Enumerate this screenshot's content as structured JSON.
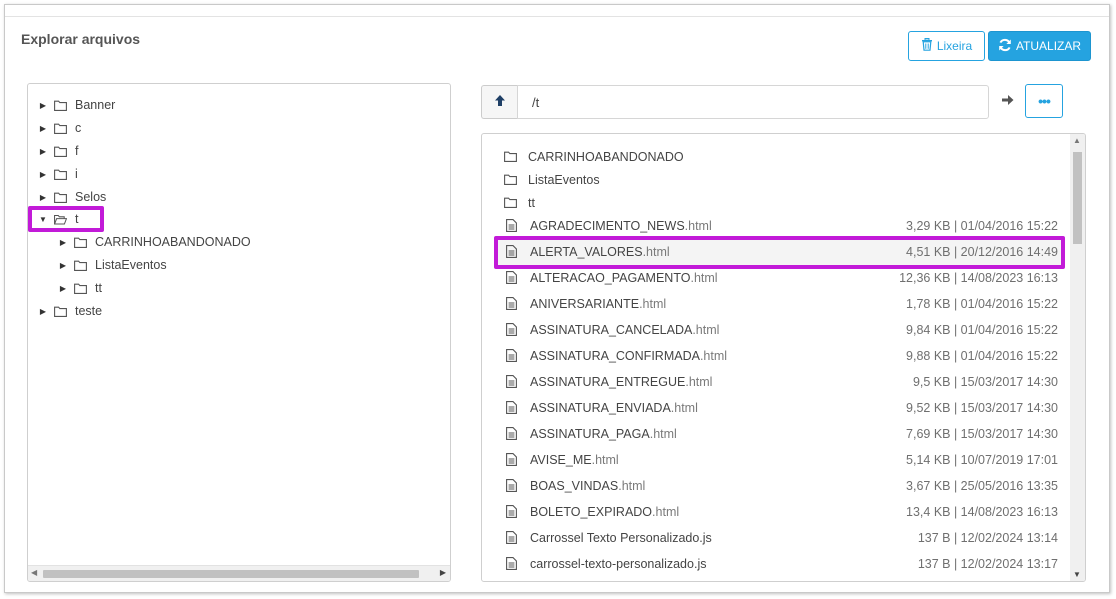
{
  "header": {
    "title": "Explorar arquivos",
    "trash_label": "Lixeira",
    "refresh_label": "ATUALIZAR"
  },
  "colors": {
    "accent": "#25a3e0",
    "highlight": "#c21ad8"
  },
  "tree": {
    "nodes": [
      {
        "label": "Banner",
        "expanded": false,
        "icon": "folder-icon"
      },
      {
        "label": "c",
        "expanded": false,
        "icon": "folder-icon"
      },
      {
        "label": "f",
        "expanded": false,
        "icon": "folder-icon"
      },
      {
        "label": "i",
        "expanded": false,
        "icon": "folder-icon"
      },
      {
        "label": "Selos",
        "expanded": false,
        "icon": "folder-icon"
      },
      {
        "label": "t",
        "expanded": true,
        "icon": "folder-open-icon",
        "selected": true
      },
      {
        "label": "CARRINHOABANDONADO",
        "expanded": false,
        "icon": "folder-icon",
        "child": true
      },
      {
        "label": "ListaEventos",
        "expanded": false,
        "icon": "folder-icon",
        "child": true
      },
      {
        "label": "tt",
        "expanded": false,
        "icon": "folder-icon",
        "child": true
      },
      {
        "label": "teste",
        "expanded": false,
        "icon": "folder-icon"
      }
    ]
  },
  "path": {
    "value": "/t"
  },
  "files": {
    "folders": [
      "CARRINHOABANDONADO",
      "ListaEventos",
      "tt"
    ],
    "items": [
      {
        "base": "AGRADECIMENTO_NEWS",
        "ext": ".html",
        "meta": "3,29 KB | 01/04/2016 15:22"
      },
      {
        "base": "ALERTA_VALORES",
        "ext": ".html",
        "meta": "4,51 KB | 20/12/2016 14:49",
        "selected": true
      },
      {
        "base": "ALTERACAO_PAGAMENTO",
        "ext": ".html",
        "meta": "12,36 KB | 14/08/2023 16:13"
      },
      {
        "base": "ANIVERSARIANTE",
        "ext": ".html",
        "meta": "1,78 KB | 01/04/2016 15:22"
      },
      {
        "base": "ASSINATURA_CANCELADA",
        "ext": ".html",
        "meta": "9,84 KB | 01/04/2016 15:22"
      },
      {
        "base": "ASSINATURA_CONFIRMADA",
        "ext": ".html",
        "meta": "9,88 KB | 01/04/2016 15:22"
      },
      {
        "base": "ASSINATURA_ENTREGUE",
        "ext": ".html",
        "meta": "9,5 KB | 15/03/2017 14:30"
      },
      {
        "base": "ASSINATURA_ENVIADA",
        "ext": ".html",
        "meta": "9,52 KB | 15/03/2017 14:30"
      },
      {
        "base": "ASSINATURA_PAGA",
        "ext": ".html",
        "meta": "7,69 KB | 15/03/2017 14:30"
      },
      {
        "base": "AVISE_ME",
        "ext": ".html",
        "meta": "5,14 KB | 10/07/2019 17:01"
      },
      {
        "base": "BOAS_VINDAS",
        "ext": ".html",
        "meta": "3,67 KB | 25/05/2016 13:35"
      },
      {
        "base": "BOLETO_EXPIRADO",
        "ext": ".html",
        "meta": "13,4 KB | 14/08/2023 16:13"
      },
      {
        "base": "Carrossel Texto Personalizado.js",
        "ext": "",
        "meta": "137 B | 12/02/2024 13:14"
      },
      {
        "base": "carrossel-texto-personalizado.js",
        "ext": "",
        "meta": "137 B | 12/02/2024 13:17"
      }
    ]
  }
}
